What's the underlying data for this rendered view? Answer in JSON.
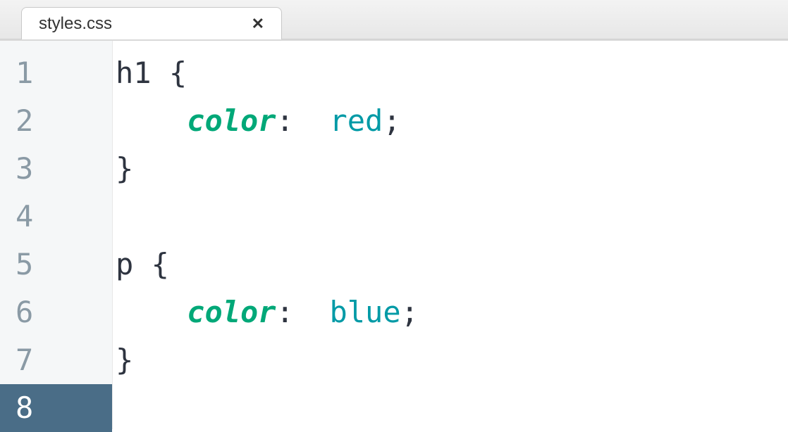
{
  "tab": {
    "title": "styles.css"
  },
  "editor": {
    "active_line_index": 7,
    "line_numbers": [
      "1",
      "2",
      "3",
      "4",
      "5",
      "6",
      "7",
      "8"
    ],
    "lines": [
      {
        "tokens": [
          {
            "cls": "tok-selector",
            "text": "h1 "
          },
          {
            "cls": "tok-brace",
            "text": "{"
          }
        ]
      },
      {
        "indent": "    ",
        "tokens": [
          {
            "cls": "tok-property",
            "text": "color"
          },
          {
            "cls": "tok-colon",
            "text": ":"
          },
          {
            "cls": "",
            "text": "  "
          },
          {
            "cls": "tok-value",
            "text": "red"
          },
          {
            "cls": "tok-semi",
            "text": ";"
          }
        ]
      },
      {
        "tokens": [
          {
            "cls": "tok-brace",
            "text": "}"
          }
        ]
      },
      {
        "tokens": []
      },
      {
        "tokens": [
          {
            "cls": "tok-selector",
            "text": "p "
          },
          {
            "cls": "tok-brace",
            "text": "{"
          }
        ]
      },
      {
        "indent": "    ",
        "tokens": [
          {
            "cls": "tok-property",
            "text": "color"
          },
          {
            "cls": "tok-colon",
            "text": ":"
          },
          {
            "cls": "",
            "text": "  "
          },
          {
            "cls": "tok-value",
            "text": "blue"
          },
          {
            "cls": "tok-semi",
            "text": ";"
          }
        ]
      },
      {
        "tokens": [
          {
            "cls": "tok-brace",
            "text": "}"
          }
        ]
      },
      {
        "tokens": []
      }
    ]
  }
}
